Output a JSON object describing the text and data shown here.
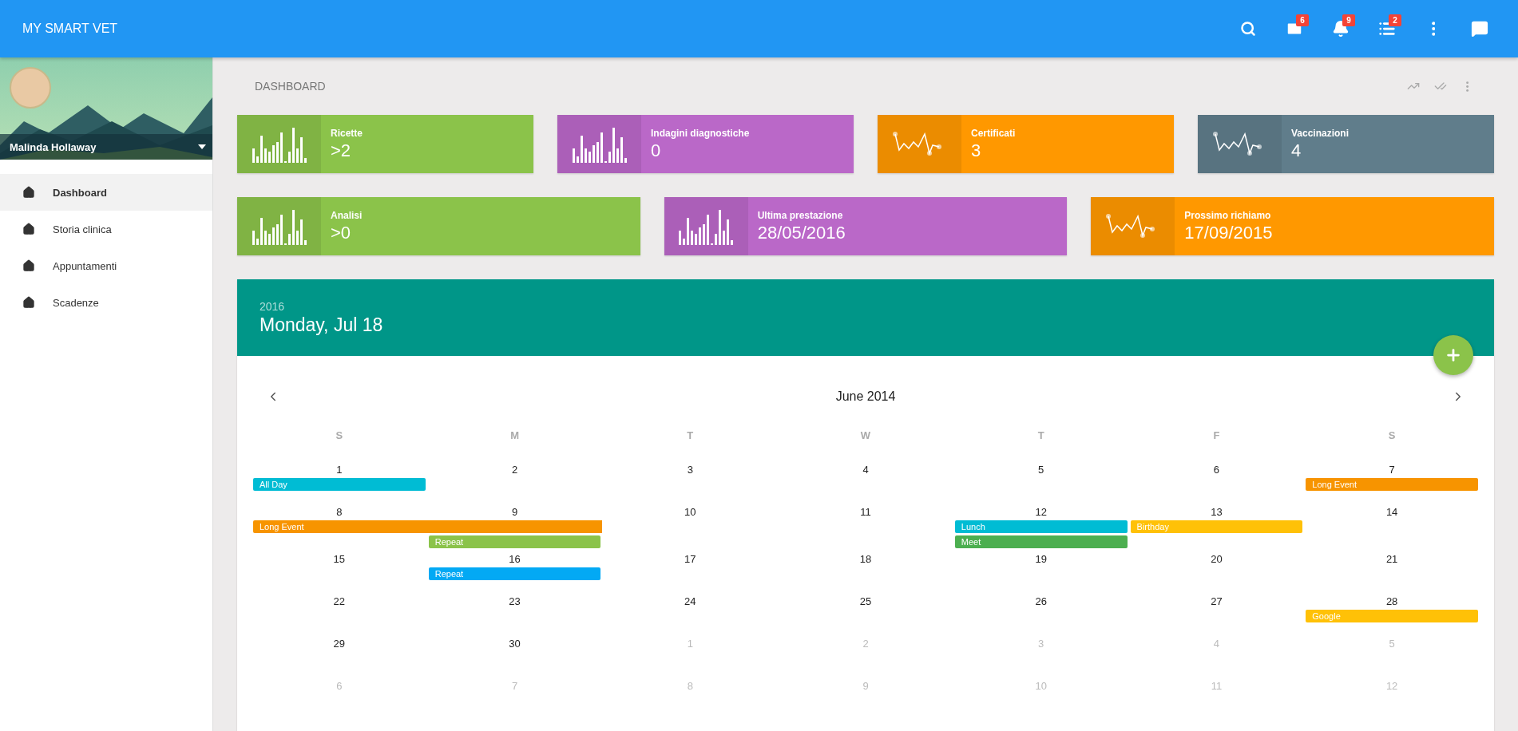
{
  "app_bar": {
    "title": "MY SMART VET",
    "actions": [
      {
        "kind": "search"
      },
      {
        "kind": "mail",
        "badge": "6"
      },
      {
        "kind": "bell",
        "badge": "9"
      },
      {
        "kind": "list",
        "badge": "2"
      },
      {
        "kind": "more"
      },
      {
        "kind": "chat"
      }
    ]
  },
  "sidebar": {
    "user": {
      "name": "Malinda Hollaway"
    },
    "items": [
      {
        "label": "Dashboard",
        "selected": true
      },
      {
        "label": "Storia clinica",
        "selected": false
      },
      {
        "label": "Appuntamenti",
        "selected": false
      },
      {
        "label": "Scadenze",
        "selected": false
      }
    ]
  },
  "page": {
    "title": "DASHBOARD",
    "tools": [
      {
        "kind": "trend"
      },
      {
        "kind": "done-all"
      },
      {
        "kind": "more"
      }
    ]
  },
  "stat_rows": [
    [
      {
        "label": "Ricette",
        "value": ">2",
        "kind": "bars",
        "color": "#8bc34a"
      },
      {
        "label": "Indagini diagnostiche",
        "value": "0",
        "kind": "bars",
        "color": "#ba68c8"
      },
      {
        "label": "Certificati",
        "value": "3",
        "kind": "line",
        "color": "#ff9800"
      },
      {
        "label": "Vaccinazioni",
        "value": "4",
        "kind": "line",
        "color": "#607d8b"
      }
    ],
    [
      {
        "label": "Analisi",
        "value": ">0",
        "kind": "bars",
        "color": "#8bc34a"
      },
      {
        "label": "Ultima prestazione",
        "value": "28/05/2016",
        "kind": "bars",
        "color": "#ba68c8"
      },
      {
        "label": "Prossimo richiamo",
        "value": "17/09/2015",
        "kind": "line",
        "color": "#ff9800"
      }
    ]
  ],
  "calendar": {
    "year": "2016",
    "date": "Monday, Jul 18",
    "month": "June 2014",
    "weekdays": [
      "S",
      "M",
      "T",
      "W",
      "T",
      "F",
      "S"
    ],
    "weeks": [
      {
        "days": [
          {
            "label": "1",
            "outside": false,
            "events": [
              {
                "title": "All Day",
                "color": "#00bcd4",
                "continues": false
              }
            ]
          },
          {
            "label": "2",
            "outside": false
          },
          {
            "label": "3",
            "outside": false
          },
          {
            "label": "4",
            "outside": false
          },
          {
            "label": "5",
            "outside": false
          },
          {
            "label": "6",
            "outside": false
          },
          {
            "label": "7",
            "outside": false,
            "events": [
              {
                "title": "Long Event",
                "color": "#f79400",
                "continues": false
              }
            ]
          }
        ]
      },
      {
        "days": [
          {
            "label": "8",
            "outside": false,
            "events": [
              {
                "title": "Long Event",
                "color": "#f79400",
                "continues": true
              }
            ]
          },
          {
            "label": "9",
            "outside": false,
            "events": [
              {
                "title": "Repeat",
                "color": "#8bc34a",
                "continues": false
              }
            ]
          },
          {
            "label": "10",
            "outside": false
          },
          {
            "label": "11",
            "outside": false
          },
          {
            "label": "12",
            "outside": false,
            "events": [
              {
                "title": "Lunch",
                "color": "#00bcd4",
                "continues": false
              },
              {
                "title": "Meet",
                "color": "#4caf50",
                "continues": false
              }
            ]
          },
          {
            "label": "13",
            "outside": false,
            "events": [
              {
                "title": "Birthday",
                "color": "#ffc107",
                "continues": false
              }
            ]
          },
          {
            "label": "14",
            "outside": false
          }
        ]
      },
      {
        "days": [
          {
            "label": "15",
            "outside": false
          },
          {
            "label": "16",
            "outside": false,
            "events": [
              {
                "title": "Repeat",
                "color": "#03a9f4",
                "continues": false
              }
            ]
          },
          {
            "label": "17",
            "outside": false
          },
          {
            "label": "18",
            "outside": false
          },
          {
            "label": "19",
            "outside": false
          },
          {
            "label": "20",
            "outside": false
          },
          {
            "label": "21",
            "outside": false
          }
        ]
      },
      {
        "days": [
          {
            "label": "22",
            "outside": false
          },
          {
            "label": "23",
            "outside": false
          },
          {
            "label": "24",
            "outside": false
          },
          {
            "label": "25",
            "outside": false
          },
          {
            "label": "26",
            "outside": false
          },
          {
            "label": "27",
            "outside": false
          },
          {
            "label": "28",
            "outside": false,
            "events": [
              {
                "title": "Google",
                "color": "#ffc107",
                "continues": false
              }
            ]
          }
        ]
      },
      {
        "days": [
          {
            "label": "29",
            "outside": false
          },
          {
            "label": "30",
            "outside": false
          },
          {
            "label": "1",
            "outside": true
          },
          {
            "label": "2",
            "outside": true
          },
          {
            "label": "3",
            "outside": true
          },
          {
            "label": "4",
            "outside": true
          },
          {
            "label": "5",
            "outside": true
          }
        ]
      },
      {
        "days": [
          {
            "label": "6",
            "outside": true
          },
          {
            "label": "7",
            "outside": true
          },
          {
            "label": "8",
            "outside": true
          },
          {
            "label": "9",
            "outside": true
          },
          {
            "label": "10",
            "outside": true
          },
          {
            "label": "11",
            "outside": true
          },
          {
            "label": "12",
            "outside": true
          }
        ]
      }
    ]
  }
}
